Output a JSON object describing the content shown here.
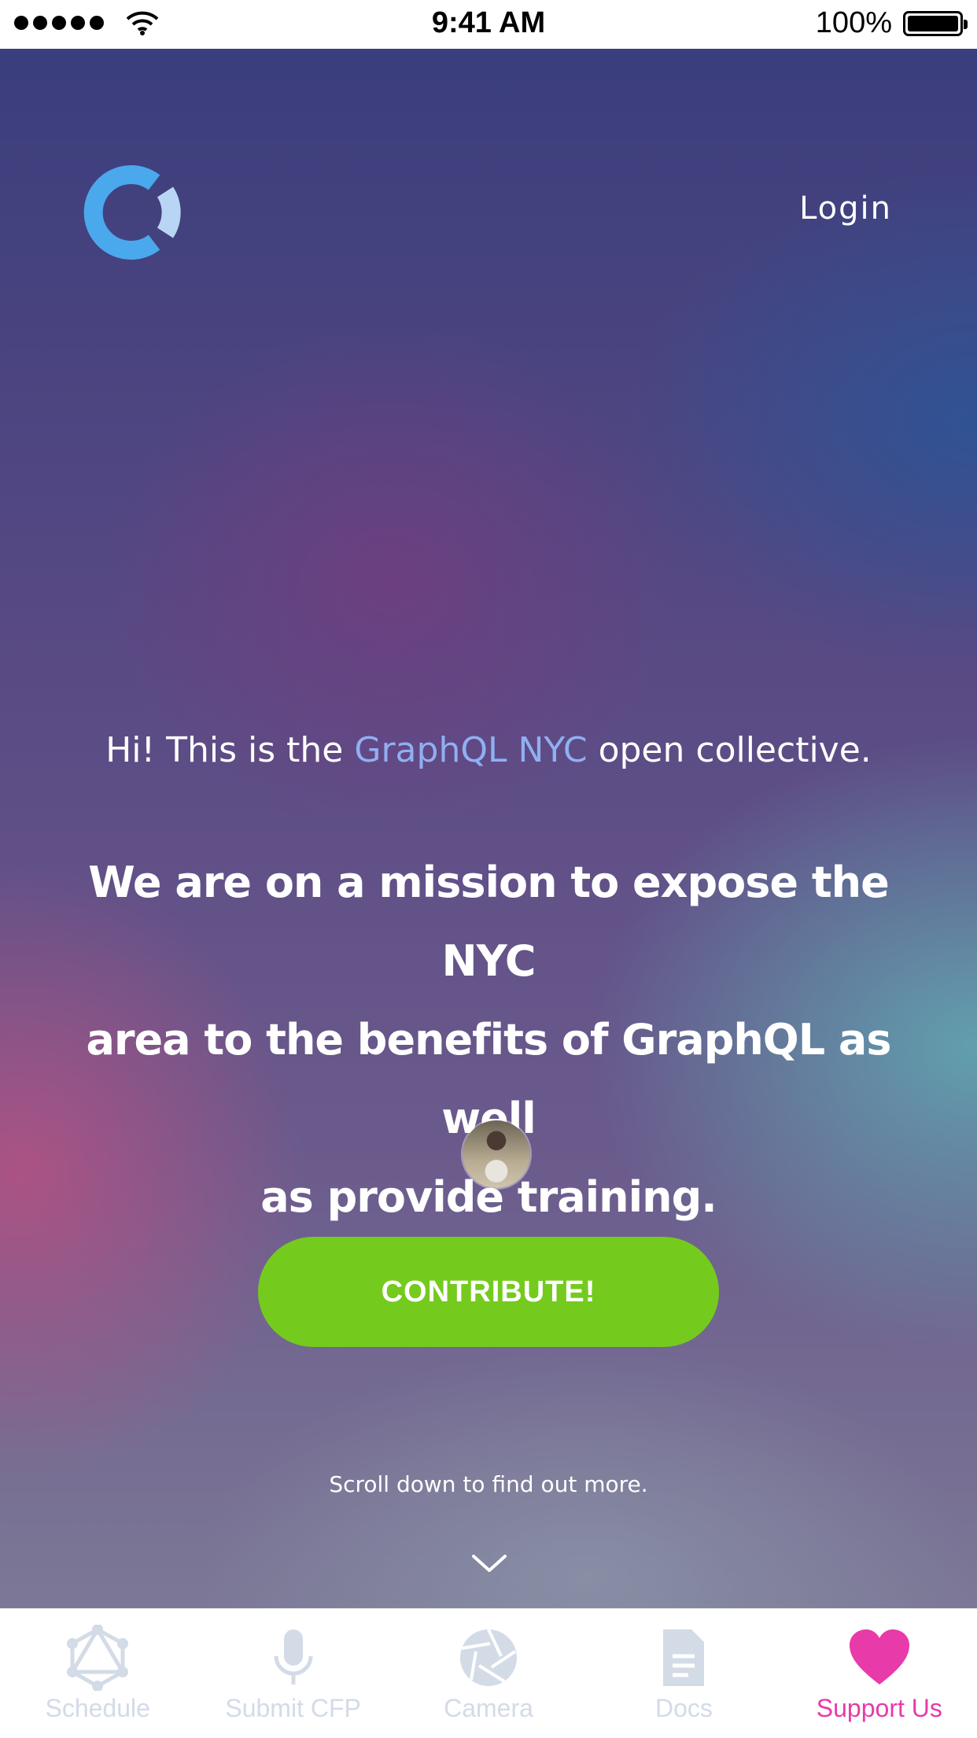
{
  "status_bar": {
    "time": "9:41 AM",
    "battery": "100%",
    "icons": [
      "signal-dots-icon",
      "wifi-icon",
      "battery-icon"
    ]
  },
  "header": {
    "logo_icon": "open-collective-logo",
    "login_label": "Login"
  },
  "hero": {
    "intro_prefix": "Hi! This is the ",
    "intro_highlight": "GraphQL NYC",
    "intro_suffix": " open collective.",
    "mission_line1": "We are on a mission to expose the NYC",
    "mission_line2": "area to the benefits of GraphQL as well",
    "mission_line3": "as provide training.",
    "contribute_label": "CONTRIBUTE!",
    "scroll_hint": "Scroll down to find out more.",
    "scroll_icon": "chevron-down-icon"
  },
  "tab_bar": {
    "tabs": [
      {
        "label": "Schedule",
        "icon": "graphql-icon",
        "active": false
      },
      {
        "label": "Submit CFP",
        "icon": "microphone-icon",
        "active": false
      },
      {
        "label": "Camera",
        "icon": "camera-aperture-icon",
        "active": false
      },
      {
        "label": "Docs",
        "icon": "document-icon",
        "active": false
      },
      {
        "label": "Support Us",
        "icon": "heart-icon",
        "active": true
      }
    ]
  },
  "colors": {
    "accent_pink": "#e83aa9",
    "contribute_green": "#74cb1e",
    "highlight_blue": "#8fb0f2",
    "inactive_tab": "#d3dbe7"
  }
}
